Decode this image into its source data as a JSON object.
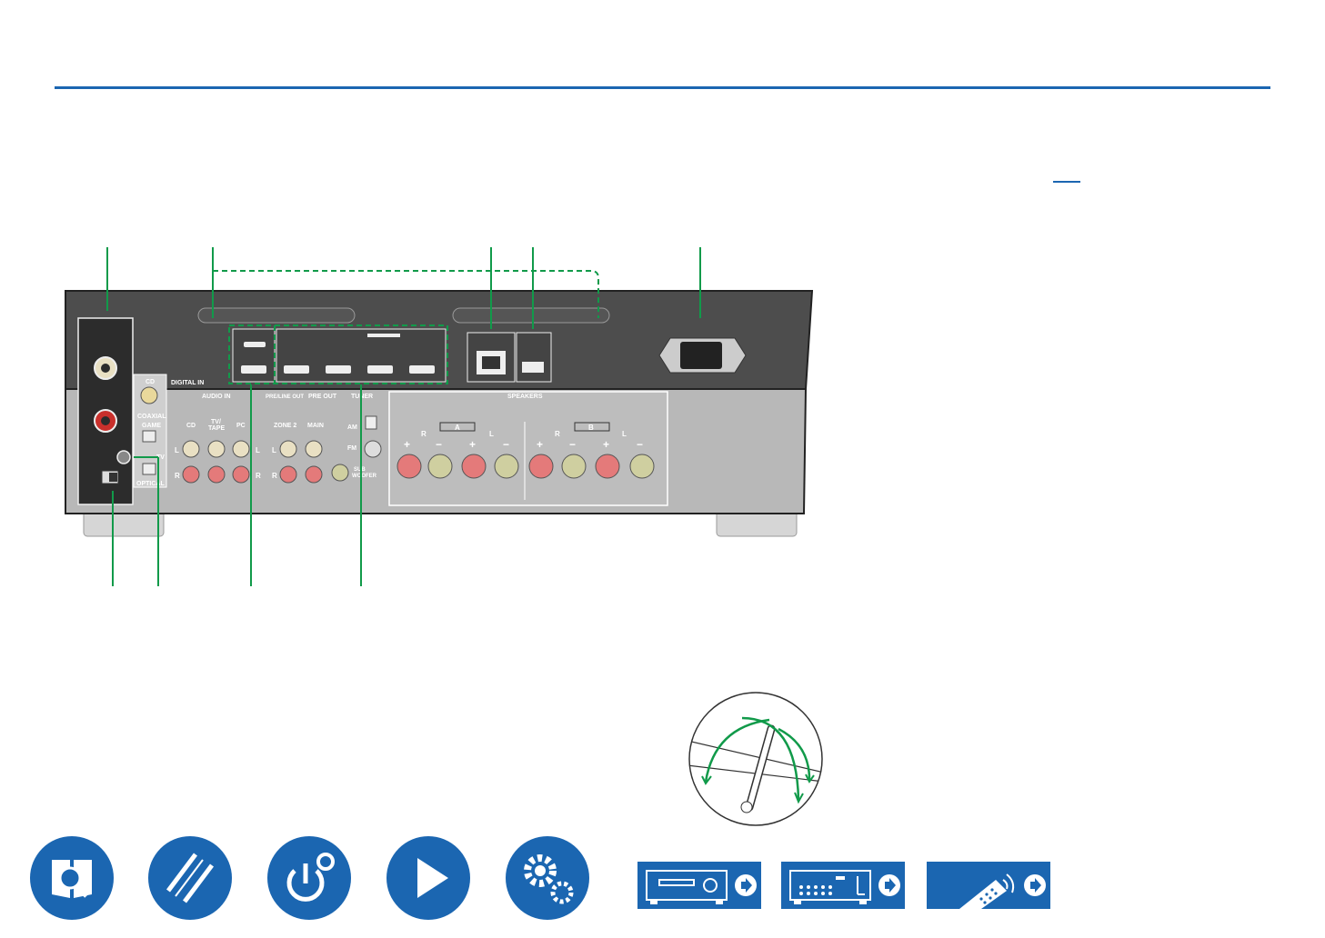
{
  "panel": {
    "digital_in": "DIGITAL IN",
    "cd_coax": "CD",
    "coaxial": "COAXIAL",
    "game": "GAME",
    "tv": "TV",
    "optical": "OPTICAL",
    "audio_in": "AUDIO IN",
    "audio_cd": "CD",
    "tv_tape_1": "TV/",
    "tv_tape_2": "TAPE",
    "pc": "PC",
    "pre_line_out": "PRE/LINE OUT",
    "pre_out": "PRE OUT",
    "tuner": "TUNER",
    "zone2": "ZONE 2",
    "main": "MAIN",
    "am": "AM",
    "fm": "FM",
    "sub1": "SUB",
    "sub2": "WOOFER",
    "speakers": "SPEAKERS",
    "a": "A",
    "b": "B",
    "r": "R",
    "l": "L",
    "plus": "+",
    "minus": "−"
  },
  "nav": [
    {
      "name": "contents-button",
      "icon": "manual-search-icon"
    },
    {
      "name": "connections-button",
      "icon": "cables-icon"
    },
    {
      "name": "setup-button",
      "icon": "power-gear-icon"
    },
    {
      "name": "playback-button",
      "icon": "play-icon"
    },
    {
      "name": "settings-button",
      "icon": "gears-icon"
    }
  ],
  "devices": [
    {
      "name": "front-panel-button",
      "icon": "front-panel-icon"
    },
    {
      "name": "rear-panel-button",
      "icon": "rear-panel-icon"
    },
    {
      "name": "remote-button",
      "icon": "remote-icon"
    }
  ],
  "colors": {
    "accent": "#1b66b1",
    "callout": "#119a4a",
    "panel": "#4a4a4a"
  }
}
